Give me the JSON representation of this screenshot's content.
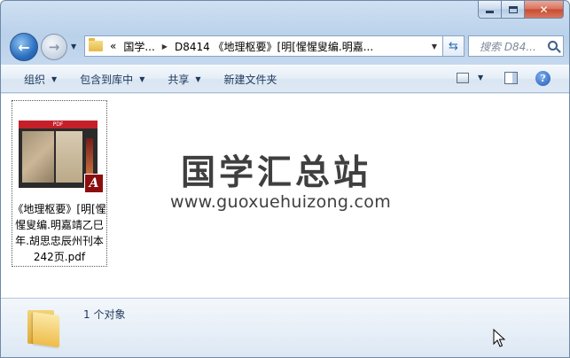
{
  "window": {
    "caption": {
      "min": "minimize",
      "max": "maximize",
      "close": "✕"
    }
  },
  "address_bar": {
    "crumbs": [
      "国学...",
      "D8414 《地理枢要》[明[惺惺叟编.明嘉..."
    ],
    "overflow_glyph": "«",
    "search_placeholder": "搜索 D84..."
  },
  "toolbar": {
    "organize": "组织",
    "include_in_library": "包含到库中",
    "share": "共享",
    "new_folder": "新建文件夹"
  },
  "files": [
    {
      "name": "《地理枢要》[明[惺惺叟编.明嘉靖乙巳年.胡思忠辰州刊本242页.pdf",
      "type": "pdf",
      "thumb_header": "PDF"
    }
  ],
  "watermark": {
    "title": "国学汇总站",
    "url": "www.guoxuehuizong.com"
  },
  "status": {
    "count": "1 个对象"
  }
}
